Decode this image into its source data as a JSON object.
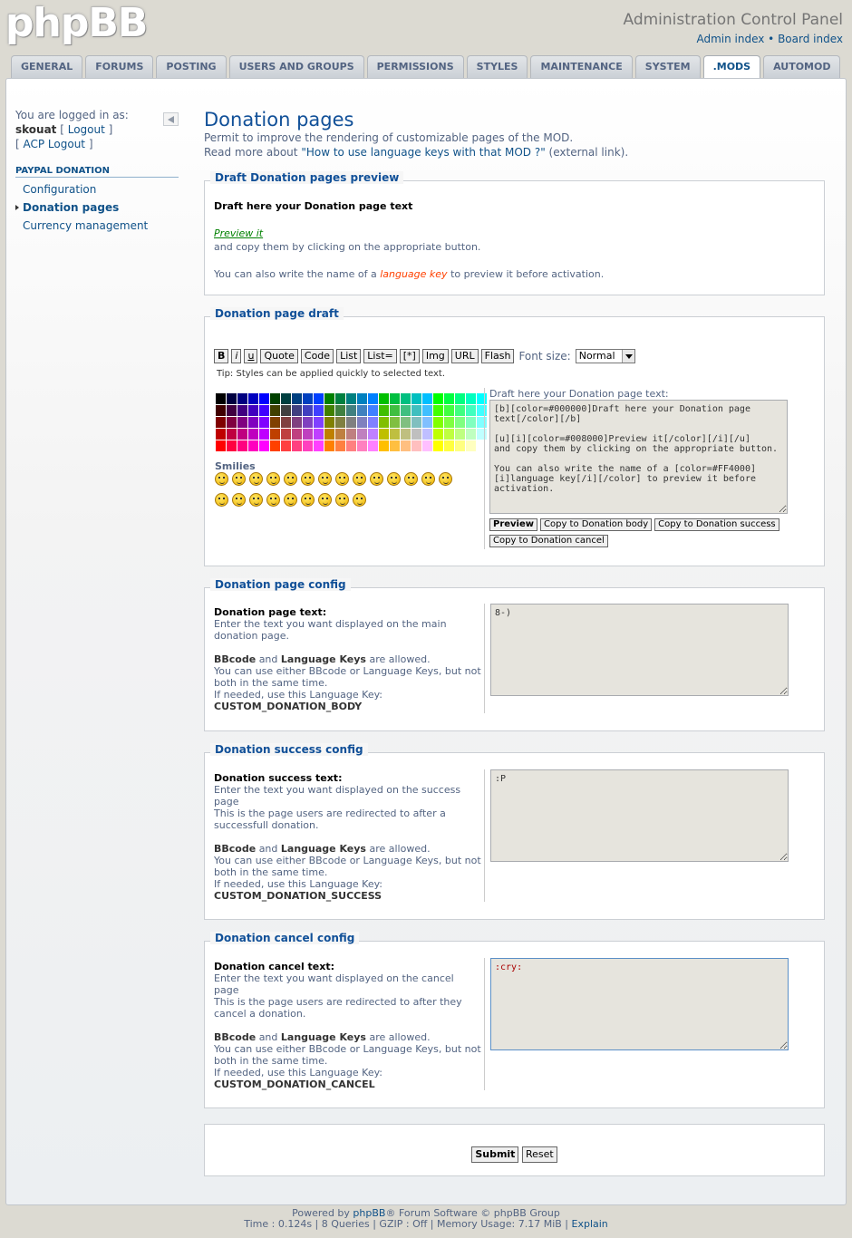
{
  "header": {
    "logo": "phpBB",
    "title": "Administration Control Panel",
    "admin_index": "Admin index",
    "sep": "•",
    "board_index": "Board index"
  },
  "tabs": [
    "GENERAL",
    "FORUMS",
    "POSTING",
    "USERS AND GROUPS",
    "PERMISSIONS",
    "STYLES",
    "MAINTENANCE",
    "SYSTEM",
    ".MODS",
    "AUTOMOD"
  ],
  "active_tab": ".MODS",
  "sidebar": {
    "logged_in_label": "You are logged in as:",
    "username": "skouat",
    "logout": "Logout",
    "acp_logout": "ACP Logout",
    "menu_header": "PAYPAL DONATION",
    "items": [
      "Configuration",
      "Donation pages",
      "Currency management"
    ]
  },
  "main": {
    "title": "Donation pages",
    "intro1": "Permit to improve the rendering of customizable pages of the MOD.",
    "intro2_prefix": "Read more about",
    "intro2_link": "\"How to use language keys with that MOD ?\"",
    "intro2_suffix": "(external link)."
  },
  "preview": {
    "legend": "Draft Donation pages preview",
    "heading": "Draft here your Donation page text",
    "preview_link": "Preview it",
    "copy_text": "and copy them by clicking on the appropriate button.",
    "also_prefix": "You can also write the name of a",
    "also_key": "language key",
    "also_suffix": "to preview it before activation."
  },
  "draft": {
    "legend": "Donation page draft",
    "bbcode_buttons": [
      "B",
      "i",
      "u",
      "Quote",
      "Code",
      "List",
      "List=",
      "[*]",
      "Img",
      "URL",
      "Flash"
    ],
    "font_size_label": "Font size:",
    "font_size_value": "Normal",
    "tip": "Tip: Styles can be applied quickly to selected text.",
    "smilies_label": "Smilies",
    "textarea_label": "Draft here your Donation page text:",
    "textarea_value": "[b][color=#000000]Draft here your Donation page text[/color][/b]\n\n[u][i][color=#008000]Preview it[/color][/i][/u]\nand copy them by clicking on the appropriate button.\n\nYou can also write the name of a [color=#FF4000][i]language key[/i][/color] to preview it before activation.",
    "btn_preview": "Preview",
    "btn_copy_body": "Copy to Donation body",
    "btn_copy_success": "Copy to Donation success",
    "btn_copy_cancel": "Copy to Donation cancel"
  },
  "config_page": {
    "legend": "Donation page config",
    "label": "Donation page text:",
    "desc": "Enter the text you want displayed on the main donation page.",
    "bb1": "BBcode",
    "and": "and",
    "bb2": "Language Keys",
    "allowed": "are allowed.",
    "either": "You can use either BBcode or Language Keys, but not both in the same time.",
    "if_needed": "If needed, use this Language Key:",
    "key": "CUSTOM_DONATION_BODY",
    "value": "8-)"
  },
  "config_success": {
    "legend": "Donation success config",
    "label": "Donation success text:",
    "desc": "Enter the text you want displayed on the success page",
    "desc2": "This is the page users are redirected to after a successfull donation.",
    "bb1": "BBcode",
    "and": "and",
    "bb2": "Language Keys",
    "allowed": "are allowed.",
    "either": "You can use either BBcode or Language Keys, but not both in the same time.",
    "if_needed": "If needed, use this Language Key:",
    "key": "CUSTOM_DONATION_SUCCESS",
    "value": ":P"
  },
  "config_cancel": {
    "legend": "Donation cancel config",
    "label": "Donation cancel text:",
    "desc": "Enter the text you want displayed on the cancel page",
    "desc2": "This is the page users are redirected to after they cancel a donation.",
    "bb1": "BBcode",
    "and": "and",
    "bb2": "Language Keys",
    "allowed": "are allowed.",
    "either": "You can use either BBcode or Language Keys, but not both in the same time.",
    "if_needed": "If needed, use this Language Key:",
    "key": "CUSTOM_DONATION_CANCEL",
    "value": ":cry:"
  },
  "actions": {
    "submit": "Submit",
    "reset": "Reset"
  },
  "footer": {
    "powered_prefix": "Powered by",
    "phpbb": "phpBB",
    "powered_suffix": "® Forum Software © phpBB Group",
    "stats": "Time : 0.124s | 8 Queries | GZIP : Off | Memory Usage: 7.17 MiB |",
    "explain": "Explain"
  },
  "colors": {
    "accent": "#105289",
    "title": "#115098",
    "background": "#dcdad2",
    "preview_green": "#008000",
    "language_key_orange": "#FF4000"
  }
}
